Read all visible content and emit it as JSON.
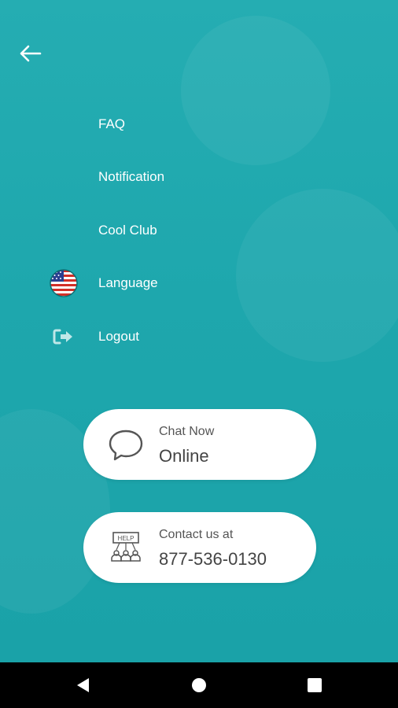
{
  "menu": {
    "items": [
      {
        "label": "FAQ",
        "icon": ""
      },
      {
        "label": "Notification",
        "icon": ""
      },
      {
        "label": "Cool Club",
        "icon": ""
      },
      {
        "label": "Language",
        "icon": "us-flag-icon"
      },
      {
        "label": "Logout",
        "icon": "logout-icon"
      }
    ]
  },
  "cards": {
    "chat": {
      "subtitle": "Chat Now",
      "title": "Online",
      "icon": "chat-bubble-icon"
    },
    "contact": {
      "subtitle": "Contact us at",
      "title": "877-536-0130",
      "icon": "help-desk-icon",
      "icon_text": "HELP"
    }
  },
  "colors": {
    "background": "#1fa9ae",
    "card": "#ffffff",
    "text": "#ffffff"
  },
  "navbar": {
    "icons": [
      "back-triangle-icon",
      "home-circle-icon",
      "recents-square-icon"
    ]
  }
}
